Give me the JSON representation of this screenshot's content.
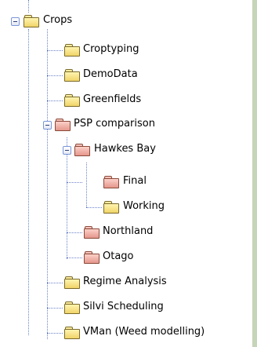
{
  "tree": {
    "root": {
      "label": "Crops",
      "color": "yellow",
      "expanded": true
    },
    "items": [
      {
        "label": "Croptyping",
        "color": "yellow"
      },
      {
        "label": "DemoData",
        "color": "yellow"
      },
      {
        "label": "Greenfields",
        "color": "yellow"
      },
      {
        "label": "PSP comparison",
        "color": "pink",
        "expanded": true
      },
      {
        "label": "Hawkes Bay",
        "color": "pink",
        "expanded": true
      },
      {
        "label": "Final",
        "color": "pink"
      },
      {
        "label": "Working",
        "color": "yellow"
      },
      {
        "label": "Northland",
        "color": "pink"
      },
      {
        "label": "Otago",
        "color": "pink"
      },
      {
        "label": "Regime Analysis",
        "color": "yellow"
      },
      {
        "label": "Silvi Scheduling",
        "color": "yellow"
      },
      {
        "label": "VMan (Weed modelling)",
        "color": "yellow"
      }
    ]
  },
  "colors": {
    "yellow_folder": "#f0d468",
    "pink_folder": "#e5978c",
    "tree_lines": "#6c84c9",
    "side_panel": "#c6d4b8"
  }
}
